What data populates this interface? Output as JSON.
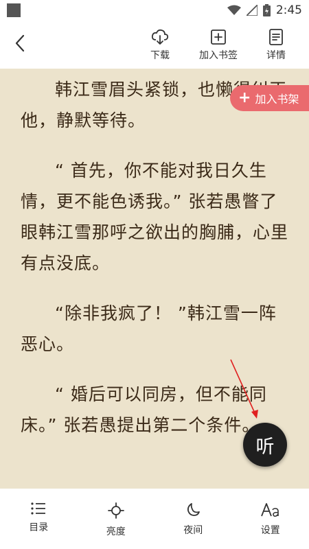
{
  "status": {
    "time": "2:45"
  },
  "toolbar": {
    "download": {
      "label": "下载",
      "icon": "cloud-download-icon"
    },
    "bookmark": {
      "label": "加入书签",
      "icon": "bookmark-add-icon"
    },
    "detail": {
      "label": "详情",
      "icon": "document-icon"
    }
  },
  "reader": {
    "paragraphs": [
      "韩江雪眉头紧锁，也懒得纠正他，静默等待。",
      "“ 首先，你不能对我日久生情，更不能色诱我。” 张若愚瞥了眼韩江雪那呼之欲出的胸脯，心里有点没底。",
      "“除非我疯了！ ”韩江雪一阵恶心。",
      "“ 婚后可以同房，但不能同床。” 张若愚提出第二个条件。"
    ],
    "background_color": "#ece3cc",
    "text_color": "#3b2a18"
  },
  "add_shelf": {
    "label": "加入书架",
    "color": "#ea6a6e"
  },
  "listen": {
    "label": "听"
  },
  "bottom_nav": [
    {
      "label": "目录",
      "icon": "list-icon"
    },
    {
      "label": "亮度",
      "icon": "brightness-icon"
    },
    {
      "label": "夜间",
      "icon": "moon-icon"
    },
    {
      "label": "设置",
      "icon": "font-settings-icon"
    }
  ]
}
